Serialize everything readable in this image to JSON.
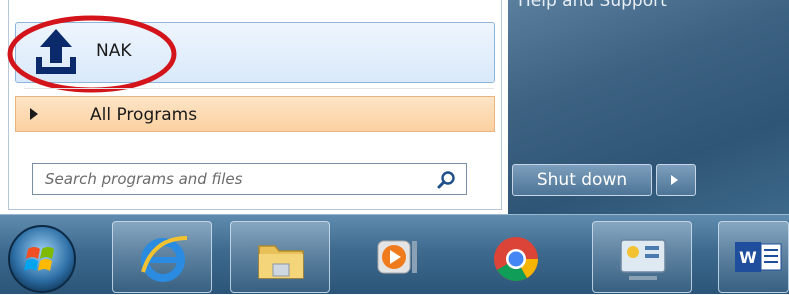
{
  "start_menu": {
    "pinned_item": {
      "label": "NAK",
      "icon": "upload-icon"
    },
    "all_programs": {
      "label": "All Programs",
      "icon": "right-arrow-icon"
    },
    "search": {
      "placeholder": "Search programs and files",
      "icon": "search-icon"
    }
  },
  "right_panel": {
    "help_label": "Help and Support",
    "shutdown_label": "Shut down",
    "shutdown_arrow_icon": "chevron-right-icon"
  },
  "taskbar": {
    "items": [
      {
        "name": "start-orb",
        "icon": "windows-logo-icon"
      },
      {
        "name": "internet-explorer",
        "icon": "ie-icon"
      },
      {
        "name": "file-explorer",
        "icon": "folder-icon"
      },
      {
        "name": "media-player",
        "icon": "media-player-icon"
      },
      {
        "name": "chrome",
        "icon": "chrome-icon"
      },
      {
        "name": "control-panel",
        "icon": "control-panel-icon"
      },
      {
        "name": "word",
        "icon": "word-icon"
      }
    ]
  },
  "colors": {
    "annotation_circle": "#d3141b",
    "hover_blue": "#d9e9fa",
    "all_programs_orange": "#fbd1a1",
    "right_panel_blue": "#3d6282",
    "taskbar_blue": "#3e6a8f"
  }
}
